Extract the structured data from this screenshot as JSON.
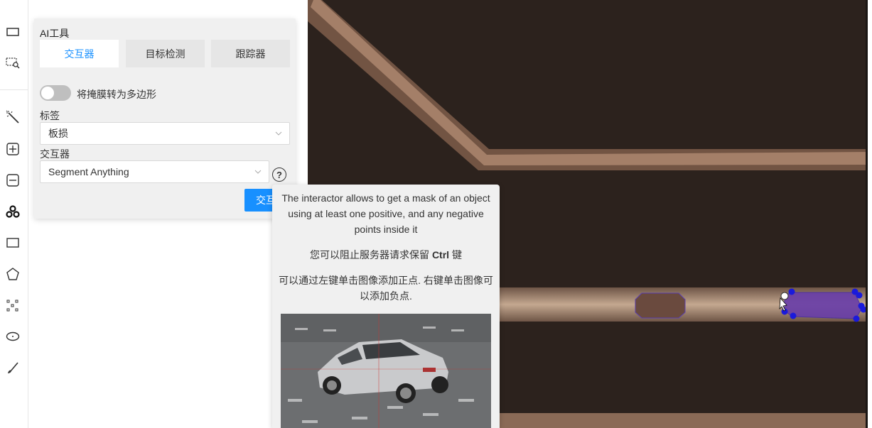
{
  "toolbar": {
    "tools": [
      "fit-screen-icon",
      "zoom-region-icon",
      "magic-wand-icon",
      "add-plus-icon",
      "remove-minus-icon",
      "opencv-icon",
      "rectangle-icon",
      "polygon-icon",
      "points-icon",
      "ellipse-icon",
      "brush-icon"
    ]
  },
  "ai_panel": {
    "title": "AI工具",
    "tabs": [
      {
        "label": "交互器",
        "active": true
      },
      {
        "label": "目标检测",
        "active": false
      },
      {
        "label": "跟踪器",
        "active": false
      }
    ],
    "convert_mask_switch": {
      "label": "将掩膜转为多边形",
      "on": false
    },
    "label_field": {
      "label": "标签",
      "value": "板损"
    },
    "interactor_field": {
      "label": "交互器",
      "value": "Segment Anything"
    },
    "help_icon": "?",
    "interact_button": "交互"
  },
  "tooltip": {
    "line1": "The interactor allows to get a mask of an object using at least one positive, and any negative points inside it",
    "line2_prefix": "您可以阻止服务器请求保留",
    "line2_key": "Ctrl",
    "line2_suffix": "键",
    "line3": "可以通过左键单击图像添加正点. 右键单击图像可以添加负点."
  },
  "colors": {
    "accent": "#1890ff",
    "canvas_bg": "#2e241f",
    "annotation_fill": "#6a3fa8",
    "control_point": "#1a1adb"
  }
}
